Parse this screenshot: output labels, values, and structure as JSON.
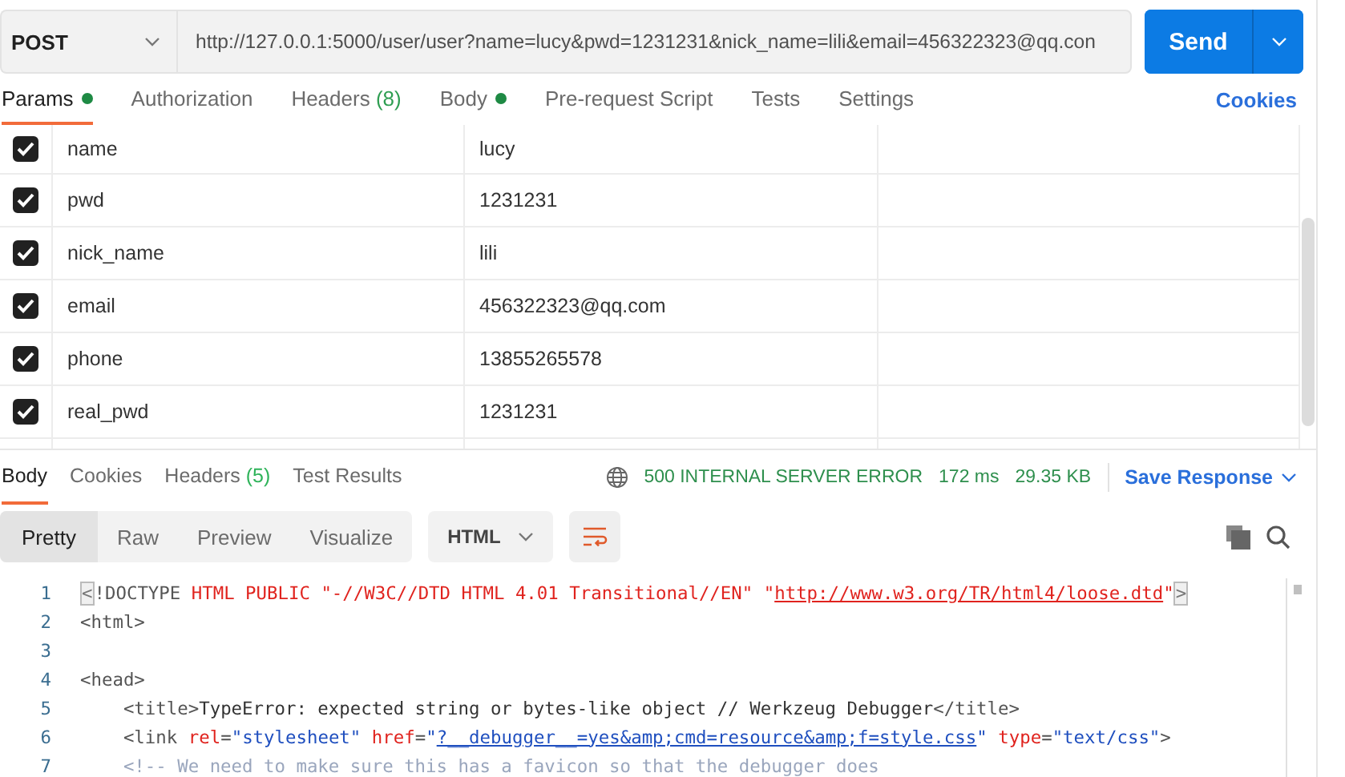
{
  "request": {
    "method": "POST",
    "url": "http://127.0.0.1:5000/user/user?name=lucy&pwd=1231231&nick_name=lili&email=456322323@qq.con",
    "send": "Send"
  },
  "request_tabs": [
    {
      "label": "Params",
      "dot": true,
      "selected": true
    },
    {
      "label": "Authorization",
      "dot": false,
      "selected": false
    },
    {
      "label": "Headers",
      "count": "(8)",
      "dot": false,
      "selected": false
    },
    {
      "label": "Body",
      "dot": true,
      "selected": false
    },
    {
      "label": "Pre-request Script",
      "dot": false,
      "selected": false
    },
    {
      "label": "Tests",
      "dot": false,
      "selected": false
    },
    {
      "label": "Settings",
      "dot": false,
      "selected": false
    }
  ],
  "cookies_link": "Cookies",
  "params": [
    {
      "key": "name",
      "value": "lucy",
      "checked": true
    },
    {
      "key": "pwd",
      "value": "1231231",
      "checked": true
    },
    {
      "key": "nick_name",
      "value": "lili",
      "checked": true
    },
    {
      "key": "email",
      "value": "456322323@qq.com",
      "checked": true
    },
    {
      "key": "phone",
      "value": "13855265578",
      "checked": true
    },
    {
      "key": "real_pwd",
      "value": "1231231",
      "checked": true
    }
  ],
  "response_tabs": [
    {
      "label": "Body",
      "selected": true
    },
    {
      "label": "Cookies",
      "selected": false
    },
    {
      "label": "Headers",
      "count": "(5)",
      "selected": false
    },
    {
      "label": "Test Results",
      "selected": false
    }
  ],
  "status": {
    "code": "500 INTERNAL SERVER ERROR",
    "time": "172 ms",
    "size": "29.35 KB"
  },
  "save_response": "Save Response",
  "view_modes": [
    {
      "label": "Pretty",
      "selected": true
    },
    {
      "label": "Raw",
      "selected": false
    },
    {
      "label": "Preview",
      "selected": false
    },
    {
      "label": "Visualize",
      "selected": false
    }
  ],
  "format": "HTML",
  "code": [
    {
      "number": "1",
      "tokens": [
        {
          "kind": "bracket",
          "text": "<"
        },
        {
          "kind": "tag",
          "text": "!DOCTYPE"
        },
        {
          "kind": "keyword",
          "text": " HTML PUBLIC \"-//W3C//DTD HTML 4.01 Transitional//EN\" \""
        },
        {
          "kind": "url",
          "text": "http://www.w3.org/TR/html4/loose.dtd"
        },
        {
          "kind": "keyword",
          "text": "\""
        },
        {
          "kind": "bracket",
          "text": ">"
        }
      ]
    },
    {
      "number": "2",
      "tokens": [
        {
          "kind": "tag",
          "text": "<html>"
        }
      ]
    },
    {
      "number": "3"
    },
    {
      "number": "4",
      "tokens": [
        {
          "kind": "tag",
          "text": "<head>"
        }
      ]
    },
    {
      "number": "5",
      "tokens": [
        {
          "kind": "tag",
          "text": "    <title>"
        },
        {
          "kind": "text",
          "text": "TypeError: expected string or bytes-like object // Werkzeug Debugger"
        },
        {
          "kind": "tag",
          "text": "</title>"
        }
      ]
    },
    {
      "number": "6",
      "tokens": [
        {
          "kind": "tag",
          "text": "    <link "
        },
        {
          "kind": "attr",
          "text": "rel"
        },
        {
          "kind": "tag",
          "text": "="
        },
        {
          "kind": "value",
          "text": "\"stylesheet\""
        },
        {
          "kind": "attr",
          "text": " href"
        },
        {
          "kind": "tag",
          "text": "="
        },
        {
          "kind": "value",
          "text": "\""
        },
        {
          "kind": "link",
          "text": "?__debugger__=yes&amp;cmd=resource&amp;f=style.css"
        },
        {
          "kind": "value",
          "text": "\""
        },
        {
          "kind": "attr",
          "text": " type"
        },
        {
          "kind": "tag",
          "text": "="
        },
        {
          "kind": "value",
          "text": "\"text/css\""
        },
        {
          "kind": "tag",
          "text": ">"
        }
      ]
    },
    {
      "number": "7",
      "tokens": [
        {
          "kind": "comment",
          "text": "    <!-- We need to make sure this has a favicon so that the debugger does"
        }
      ]
    }
  ]
}
